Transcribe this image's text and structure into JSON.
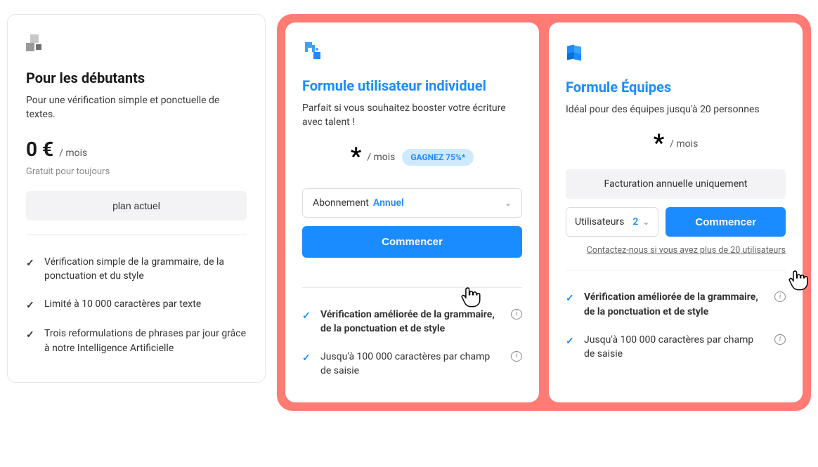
{
  "free": {
    "title": "Pour les débutants",
    "subtitle": "Pour une vérification simple et ponctuelle de textes.",
    "price": "0 €",
    "unit": "/ mois",
    "note": "Gratuit pour toujours",
    "button": "plan actuel",
    "features": [
      "Vérification simple de la grammaire, de la ponctuation et du style",
      "Limité à 10 000 caractères par texte",
      "Trois reformulations de phrases par jour grâce à notre Intelligence Artificielle"
    ]
  },
  "individual": {
    "title": "Formule utilisateur individuel",
    "subtitle": "Parfait si vous souhaitez booster votre écriture avec talent !",
    "price_symbol": "*",
    "unit": "/ mois",
    "save_badge": "GAGNEZ 75%*",
    "select_label": "Abonnement",
    "select_value": "Annuel",
    "button": "Commencer",
    "features": [
      {
        "text": "Vérification améliorée de la grammaire, de la ponctuation et de style",
        "bold": true
      },
      {
        "text": "Jusqu'à 100 000 caractères par champ de saisie",
        "bold": false
      }
    ]
  },
  "team": {
    "title": "Formule Équipes",
    "subtitle": "Idéal pour des équipes jusqu'à 20 personnes",
    "price_symbol": "*",
    "unit": "/ mois",
    "billing_note": "Facturation annuelle uniquement",
    "users_label": "Utilisateurs",
    "users_value": "2",
    "button": "Commencer",
    "contact": "Contactez-nous si vous avez plus de 20 utilisateurs",
    "features": [
      {
        "text": "Vérification améliorée de la grammaire, de la ponctuation et de style",
        "bold": true
      },
      {
        "text": "Jusqu'à 100 000 caractères par champ de saisie",
        "bold": false
      }
    ]
  }
}
